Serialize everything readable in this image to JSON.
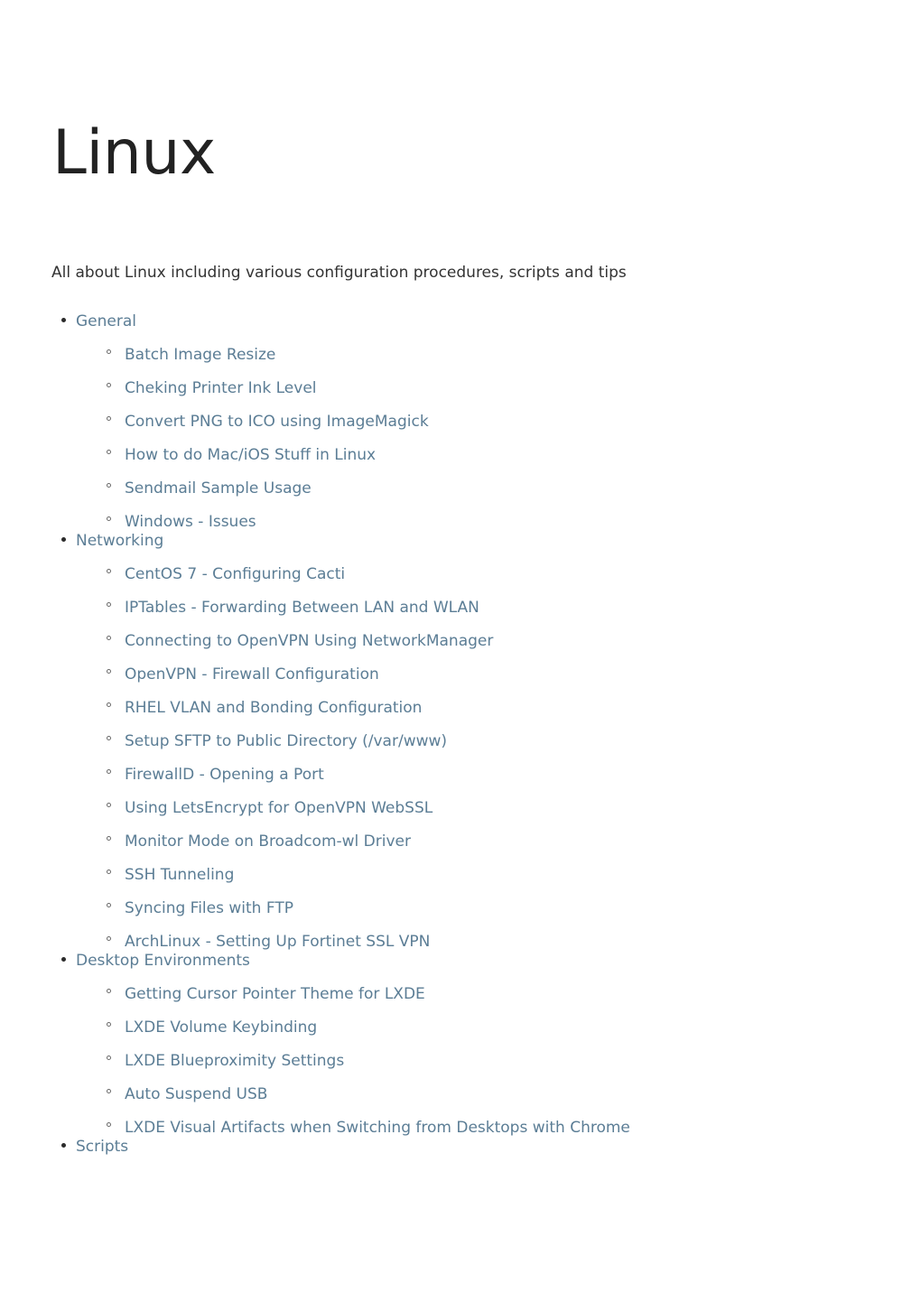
{
  "page": {
    "title": "Linux",
    "subtitle": "All about Linux including various configuration procedures, scripts and tips",
    "title_color": "#222222",
    "link_color": "#5b7d95",
    "background_color": "#ffffff",
    "bullet_level1_icon": "filled-disc-bullet-icon",
    "bullet_level2_icon": "hollow-circle-bullet-icon"
  },
  "toc": {
    "categories": [
      {
        "label": "General",
        "items": [
          {
            "label": "Batch Image Resize"
          },
          {
            "label": "Cheking Printer Ink Level"
          },
          {
            "label": "Convert PNG to ICO using ImageMagick"
          },
          {
            "label": "How to do Mac/iOS Stuff in Linux"
          },
          {
            "label": "Sendmail Sample Usage"
          },
          {
            "label": "Windows - Issues"
          }
        ]
      },
      {
        "label": "Networking",
        "items": [
          {
            "label": "CentOS 7 - Configuring Cacti"
          },
          {
            "label": "IPTables - Forwarding Between LAN and WLAN"
          },
          {
            "label": "Connecting to OpenVPN Using NetworkManager"
          },
          {
            "label": "OpenVPN - Firewall Configuration"
          },
          {
            "label": "RHEL VLAN and Bonding Configuration"
          },
          {
            "label": "Setup SFTP to Public Directory (/var/www)"
          },
          {
            "label": "FirewallD - Opening a Port"
          },
          {
            "label": "Using LetsEncrypt for OpenVPN WebSSL"
          },
          {
            "label": "Monitor Mode on Broadcom-wl Driver"
          },
          {
            "label": "SSH Tunneling"
          },
          {
            "label": "Syncing Files with FTP"
          },
          {
            "label": "ArchLinux - Setting Up Fortinet SSL VPN"
          }
        ]
      },
      {
        "label": "Desktop Environments",
        "items": [
          {
            "label": "Getting Cursor Pointer Theme for LXDE"
          },
          {
            "label": "LXDE Volume Keybinding"
          },
          {
            "label": "LXDE Blueproximity Settings"
          },
          {
            "label": "Auto Suspend USB"
          },
          {
            "label": "LXDE Visual Artifacts when Switching from Desktops with Chrome"
          }
        ]
      },
      {
        "label": "Scripts",
        "items": []
      }
    ]
  }
}
